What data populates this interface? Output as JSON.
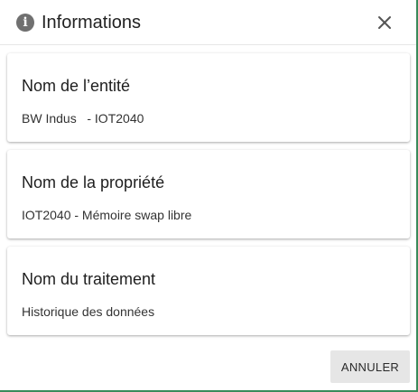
{
  "dialog": {
    "title": "Informations",
    "icon": "info-icon",
    "close_icon": "close-icon"
  },
  "cards": [
    {
      "title": "Nom de l’entité",
      "value": "BW Indus   - IOT2040"
    },
    {
      "title": "Nom de la propriété",
      "value": "IOT2040 - Mémoire swap libre"
    },
    {
      "title": "Nom du traitement",
      "value": "Historique des données"
    }
  ],
  "footer": {
    "cancel_label": "ANNULER"
  },
  "colors": {
    "accent_border": "#3a8a5a",
    "button_bg": "#e6e6e6",
    "icon_gray": "#707070"
  }
}
